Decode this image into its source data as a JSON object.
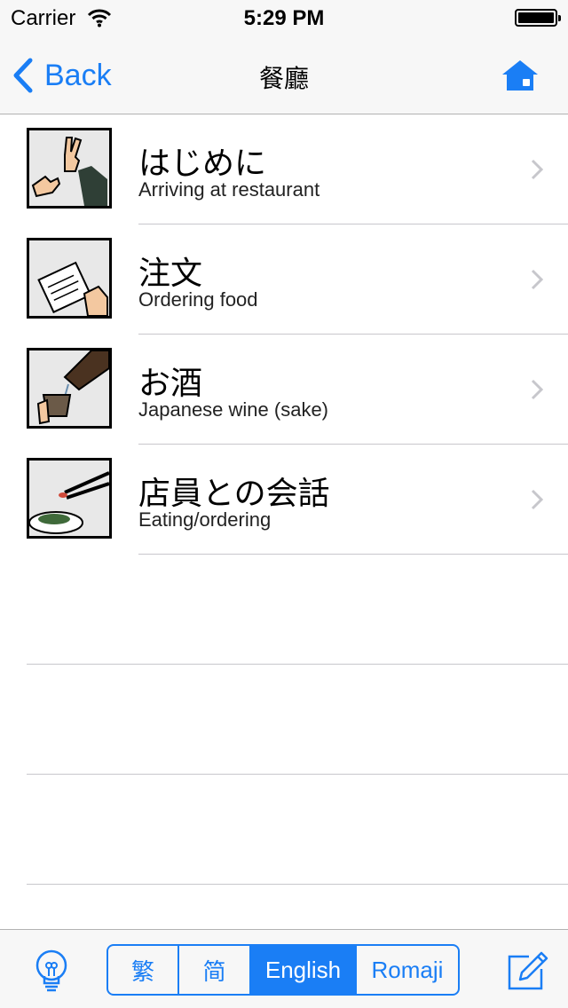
{
  "status_bar": {
    "carrier": "Carrier",
    "time": "5:29 PM"
  },
  "nav": {
    "back_label": "Back",
    "title": "餐廳",
    "home_icon": "home-icon"
  },
  "rows": [
    {
      "title": "はじめに",
      "subtitle": "Arriving at restaurant",
      "image": "peace-sign-hands"
    },
    {
      "title": "注文",
      "subtitle": "Ordering food",
      "image": "menu-in-hand"
    },
    {
      "title": "お酒",
      "subtitle": "Japanese wine (sake)",
      "image": "pouring-sake"
    },
    {
      "title": "店員との会話",
      "subtitle": "Eating/ordering",
      "image": "chopsticks-and-bowl"
    }
  ],
  "toolbar": {
    "segments": [
      "繁",
      "简",
      "English",
      "Romaji"
    ],
    "selected": "English",
    "tip_icon": "lightbulb-icon",
    "edit_icon": "edit-icon"
  },
  "colors": {
    "accent": "#1a7ef5",
    "bar_bg": "#f7f7f7",
    "separator": "#c8c7cc"
  }
}
